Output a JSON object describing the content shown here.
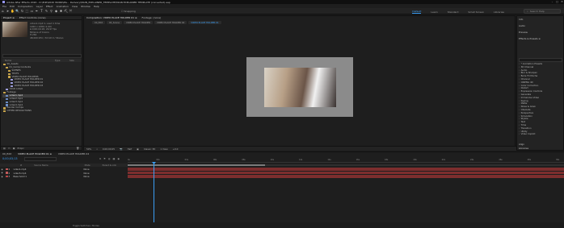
{
  "app": {
    "title": "Adobe After Effects 2020 - D:\\Edit\\2020 WORK\\Ma... Delivery\\MAIN_EXPLAINER_TEMPLATE\\MAIN EXPLAINER TEMPLATE (converted).aep",
    "window_controls": [
      "–",
      "□",
      "✕"
    ]
  },
  "menu": [
    "File",
    "Edit",
    "Composition",
    "Layer",
    "Effect",
    "Animation",
    "View",
    "Window",
    "Help"
  ],
  "toolbar": {
    "tools": [
      "⌂",
      "➤",
      "✋",
      "🔍",
      "↻",
      "⬚",
      "▭",
      "✒",
      "T",
      "✎",
      "⚲",
      "◆",
      "✱",
      "⛏",
      "⤧"
    ],
    "snapping_label": "Snapping"
  },
  "workspaces": {
    "items": [
      "Default",
      "Learn",
      "Standard",
      "Small Screen",
      "Libraries"
    ],
    "active_index": 0
  },
  "search_help": {
    "placeholder": "Search Help"
  },
  "project": {
    "tab_label": "Project ≡",
    "effect_controls_label": "Effect Controls (none)",
    "info_lines": [
      "video1.mp4 ▾, used 1 time",
      "1920 x 1080 (1.00)",
      "Δ 0;00;16;18, 29.97 fps",
      "Millions of Colors",
      "H.264",
      "48.000 kHz / 32 bit U / Stereo"
    ],
    "search_placeholder": "",
    "columns": [
      "Name",
      "Type",
      "Size"
    ],
    "tree": [
      {
        "label": "00_Assets",
        "kind": "folder",
        "indent": 0
      },
      {
        "label": "01_Comp Contents",
        "kind": "folder",
        "indent": 1
      },
      {
        "label": "SCENES",
        "kind": "folder",
        "indent": 2
      },
      {
        "label": "TEXTS",
        "kind": "folder",
        "indent": 2
      },
      {
        "label": "VIDEO PLACE HOLDERS",
        "kind": "folder",
        "indent": 2
      },
      {
        "label": "VIDEO PLACE HOLDER 01",
        "kind": "comp",
        "indent": 3
      },
      {
        "label": "VIDEO PLACE HOLDER 02",
        "kind": "comp",
        "indent": 3
      },
      {
        "label": "VIDEO PLACE HOLDER 03",
        "kind": "comp",
        "indent": 3
      },
      {
        "label": "YOUR LOGO",
        "kind": "comp",
        "indent": 1
      },
      {
        "label": "Footage",
        "kind": "folder",
        "indent": 0
      },
      {
        "label": "video1.mp4",
        "kind": "clip",
        "indent": 1,
        "selected": true
      },
      {
        "label": "video2.mp4",
        "kind": "clip",
        "indent": 1
      },
      {
        "label": "video3.mp4",
        "kind": "clip",
        "indent": 1
      },
      {
        "label": "video4.mp4",
        "kind": "clip",
        "indent": 1
      },
      {
        "label": "Render Comps",
        "kind": "folder",
        "indent": 0
      },
      {
        "label": "OTHER RESOLUTIONS",
        "kind": "folder",
        "indent": 0
      }
    ],
    "bottom_bits": "8 bpc"
  },
  "composition": {
    "tab_label": "Composition: VIDEO PLACE HOLDER 01 ≡",
    "footage_tab_label": "Footage: (none)",
    "sub_tabs": [
      "00_Edit",
      "02_Scene",
      "VIDEO PLACE HOLDER",
      "VIDEO PLACE HOLDER 02",
      "VIDEO PLACE HOLDER 01"
    ],
    "active_sub_tab": 4,
    "viewer_toolbar": [
      "50%",
      "⌖",
      "0;00;00;05",
      "📷",
      "Half",
      "▣",
      "Classic 3D",
      "1 View",
      "+0.0"
    ]
  },
  "right_panel": {
    "sections": [
      "Info",
      "Audio",
      "Preview",
      "Effects & Presets ≡"
    ],
    "effects_search_placeholder": "",
    "effects": [
      "* Animation Presets",
      "3D Channel",
      "Audio",
      "Blur & Sharpen",
      "Boris FX Mocha",
      "Channel",
      "CINEMA 4D",
      "Color Correction",
      "Distort",
      "Expression Controls",
      "Generate",
      "Immersive Video",
      "Keying",
      "Matte",
      "Noise & Grain",
      "Obsolete",
      "Perspective",
      "Simulation",
      "Stylize",
      "Text",
      "Time",
      "Transition",
      "Utility",
      "Video Copilot"
    ],
    "bottom_sections": [
      "Align",
      "Libraries"
    ]
  },
  "timeline": {
    "tabs": [
      "00_Edit",
      "VIDEO PLACE HOLDER 01 ≡",
      "VIDEO PLACE HOLDER 02"
    ],
    "active_tab": 1,
    "current_time": "0;00;03;13",
    "search_placeholder": "",
    "icons": [
      "⧉",
      "⚑",
      "◍",
      "▦",
      "◉"
    ],
    "ruler_ticks": [
      "0s",
      "02s",
      "04s",
      "06s",
      "08s",
      "10s",
      "12s",
      "14s",
      "16s",
      "18s",
      "20s",
      "22s",
      "24s",
      "26s",
      "28s",
      "30s"
    ],
    "columns": [
      "#",
      "Source Name",
      "Mode",
      "Parent & Link"
    ],
    "layers": [
      {
        "num": "1",
        "name": "video1.mp4",
        "parent": "None",
        "color": "#c25b5b"
      },
      {
        "num": "2",
        "name": "video5.mp4",
        "parent": "None",
        "color": "#c25b5b"
      },
      {
        "num": "3",
        "name": "Base Solid 1",
        "parent": "None",
        "color": "#b94646"
      }
    ],
    "toggle_label": "Toggle Switches / Modes"
  },
  "colors": {
    "accent": "#3b9ef5",
    "layer_track": "#7d2e2e",
    "panel": "#232323",
    "background": "#1b1b1b"
  }
}
